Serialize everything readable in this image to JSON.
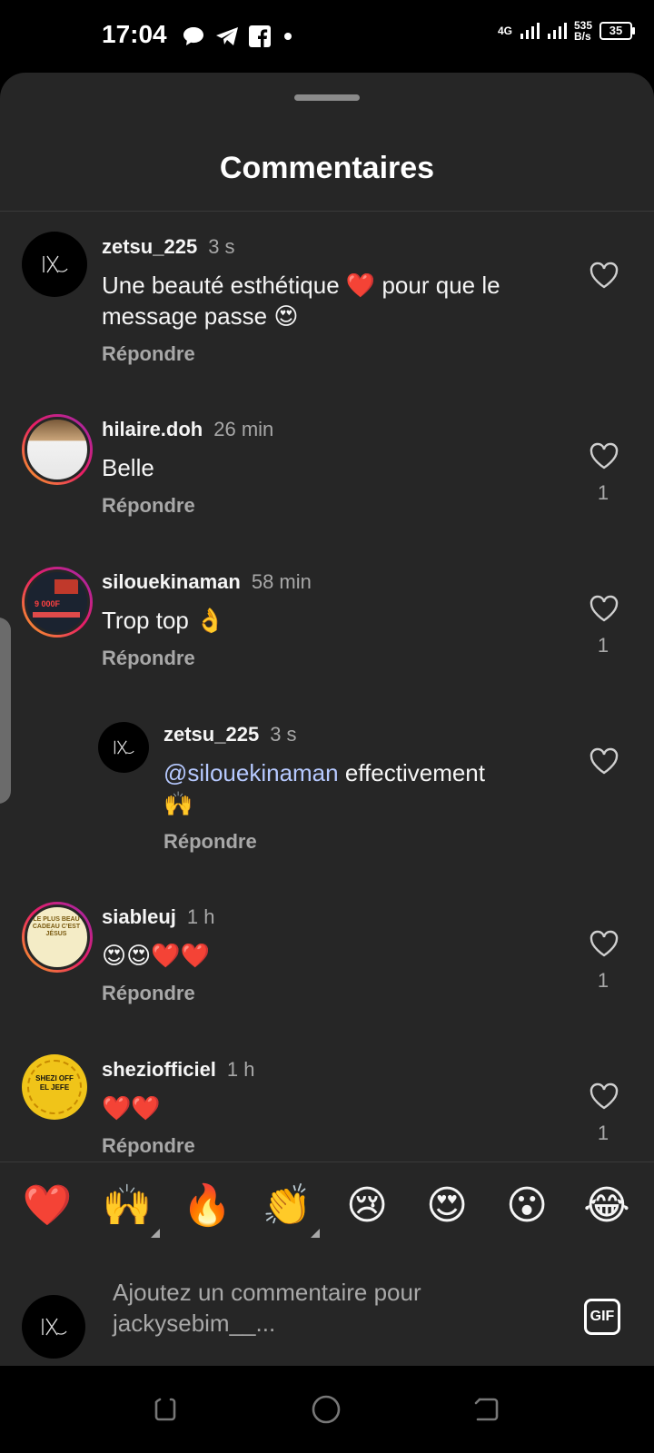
{
  "status_bar": {
    "time": "17:04",
    "network": "4G",
    "speed_value": "535",
    "speed_unit": "B/s",
    "battery": "35"
  },
  "header": {
    "title": "Commentaires"
  },
  "comments": [
    {
      "username": "zetsu_225",
      "time": "3 s",
      "text_parts": [
        "Une beauté esthétique ",
        "❤️",
        " pour que le message passe ",
        "😍"
      ],
      "reply_label": "Répondre",
      "likes": ""
    },
    {
      "username": "hilaire.doh",
      "time": "26 min",
      "text": "Belle",
      "reply_label": "Répondre",
      "likes": "1"
    },
    {
      "username": "silouekinaman",
      "time": "58 min",
      "text": "Trop top 👌",
      "reply_label": "Répondre",
      "likes": "1"
    },
    {
      "username": "zetsu_225",
      "time": "3 s",
      "mention": "@silouekinaman",
      "text": " effectivement",
      "text2": "🙌",
      "reply_label": "Répondre",
      "likes": ""
    },
    {
      "username": "siableuj",
      "time": "1 h",
      "text": "😍😍❤️❤️",
      "reply_label": "Répondre",
      "likes": "1"
    },
    {
      "username": "sheziofficiel",
      "time": "1 h",
      "text": "❤️❤️",
      "reply_label": "Répondre",
      "likes": "1"
    }
  ],
  "avatar_texts": {
    "siableuj": "LE PLUS BEAU CADEAU C'EST JÉSUS",
    "sheziofficiel": "SHEZI OFF EL JEFE",
    "silouekinaman": "9 000F"
  },
  "reactions": [
    "❤️",
    "🙌",
    "🔥",
    "👏",
    "😢",
    "😍",
    "😮",
    "😂"
  ],
  "composer": {
    "placeholder_line1": "Ajoutez un commentaire pour",
    "placeholder_line2": "jackysebim__...",
    "gif_label": "GIF"
  },
  "colors": {
    "sheet_bg": "#262626",
    "text_primary": "#f5f5f5",
    "text_secondary": "#a8a8a8",
    "mention": "#b6c9ff"
  }
}
